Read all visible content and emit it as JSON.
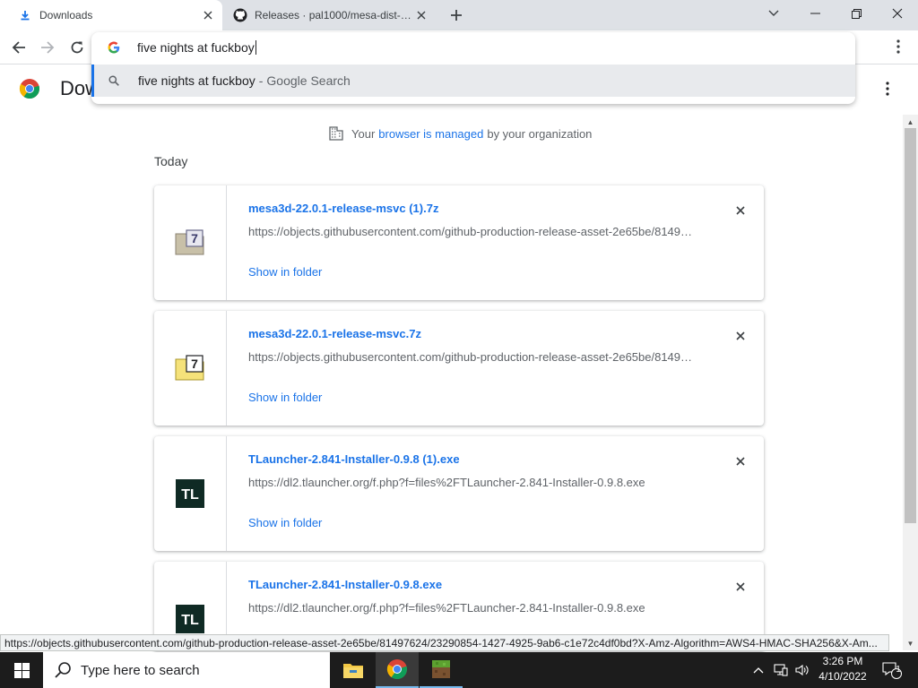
{
  "tabs": [
    {
      "title": "Downloads",
      "active": true
    },
    {
      "title": "Releases · pal1000/mesa-dist-win",
      "active": false
    }
  ],
  "omnibox": {
    "input_text": "five nights at fuckboy",
    "suggestion_query": "five nights at fuckboy",
    "suggestion_separator": "-",
    "suggestion_source": "Google Search"
  },
  "page": {
    "title": "Downloads",
    "managed_prefix": "Your",
    "managed_link": "browser is managed",
    "managed_suffix": "by your organization",
    "section_date": "Today"
  },
  "downloads": [
    {
      "filename": "mesa3d-22.0.1-release-msvc (1).7z",
      "url": "https://objects.githubusercontent.com/github-production-release-asset-2e65be/81497624/23290854-1427-4925-9ab6-c1e72c4df0bd",
      "action": "Show in folder",
      "icon": "7z-archive-icon-gray"
    },
    {
      "filename": "mesa3d-22.0.1-release-msvc.7z",
      "url": "https://objects.githubusercontent.com/github-production-release-asset-2e65be/81497624/23290854-1427-4925-9ab6-c1e72c4df0bd",
      "action": "Show in folder",
      "icon": "7z-archive-icon-yellow"
    },
    {
      "filename": "TLauncher-2.841-Installer-0.9.8 (1).exe",
      "url": "https://dl2.tlauncher.org/f.php?f=files%2FTLauncher-2.841-Installer-0.9.8.exe",
      "action": "Show in folder",
      "icon": "tlauncher-icon"
    },
    {
      "filename": "TLauncher-2.841-Installer-0.9.8.exe",
      "url": "https://dl2.tlauncher.org/f.php?f=files%2FTLauncher-2.841-Installer-0.9.8.exe",
      "action": "Show in folder",
      "icon": "tlauncher-icon"
    }
  ],
  "status_bar": "https://objects.githubusercontent.com/github-production-release-asset-2e65be/81497624/23290854-1427-4925-9ab6-c1e72c4df0bd?X-Amz-Algorithm=AWS4-HMAC-SHA256&X-Am...",
  "taskbar": {
    "search_placeholder": "Type here to search",
    "time": "3:26 PM",
    "date": "4/10/2022",
    "notification_count": "1",
    "tl_label": "TL",
    "archive_badge": "7"
  },
  "colors": {
    "accent": "#1a73e8",
    "tabstrip": "#dee1e6",
    "taskbar": "#1c1c1c"
  }
}
